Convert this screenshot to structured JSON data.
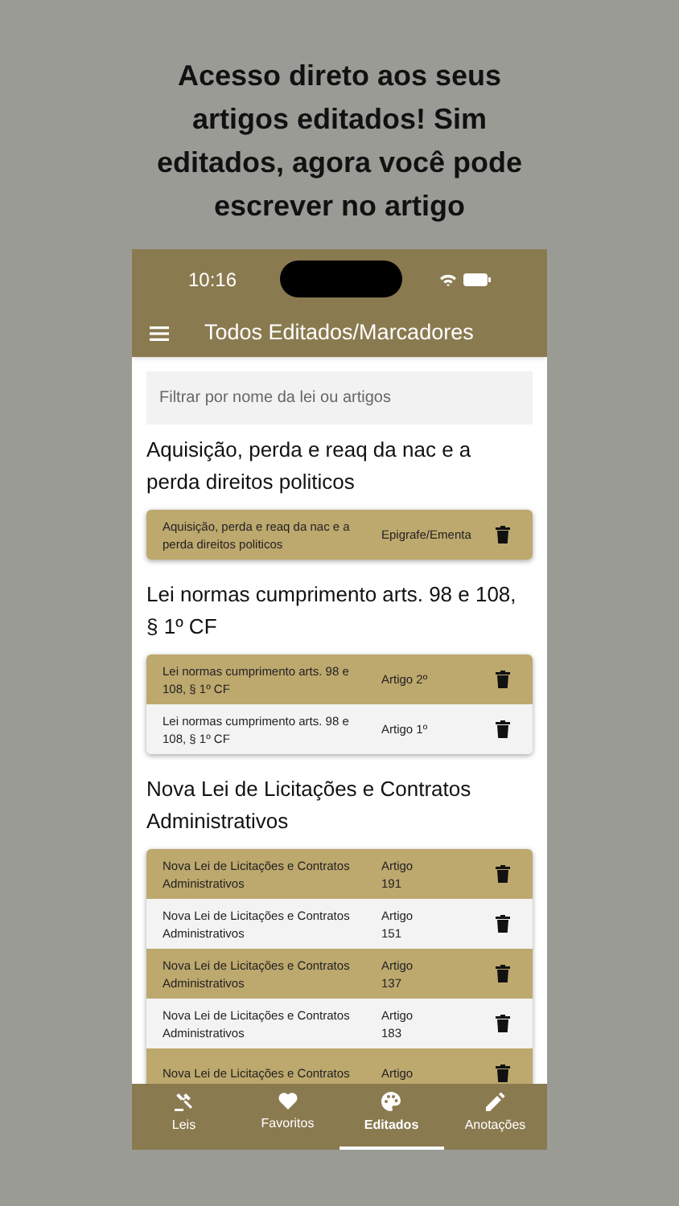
{
  "headline": "Acesso direto aos seus artigos editados! Sim editados, agora você pode escrever no artigo",
  "status_bar": {
    "time": "10:16"
  },
  "app_bar": {
    "title": "Todos Editados/Marcadores"
  },
  "search": {
    "placeholder": "Filtrar por nome da lei ou artigos"
  },
  "sections": [
    {
      "title": "Aquisição, perda e reaq da nac e a perda direitos politicos",
      "rows": [
        {
          "law": "Aquisição, perda e reaq da nac e a perda direitos politicos",
          "article": "Epigrafe/Ementa",
          "highlighted": true
        }
      ]
    },
    {
      "title": "Lei normas cumprimento arts. 98 e 108, § 1º CF",
      "rows": [
        {
          "law": "Lei normas cumprimento arts. 98 e 108, § 1º CF",
          "article": "Artigo 2º",
          "highlighted": true
        },
        {
          "law": "Lei normas cumprimento arts. 98 e 108, § 1º CF",
          "article": "Artigo 1º",
          "highlighted": false
        }
      ]
    },
    {
      "title": "Nova Lei de Licitações e Contratos Administrativos",
      "rows": [
        {
          "law": "Nova Lei de Licitações e Contratos Administrativos",
          "article": "Artigo 191",
          "highlighted": true
        },
        {
          "law": "Nova Lei de Licitações e Contratos Administrativos",
          "article": "Artigo 151",
          "highlighted": false
        },
        {
          "law": "Nova Lei de Licitações e Contratos Administrativos",
          "article": "Artigo 137",
          "highlighted": true
        },
        {
          "law": "Nova Lei de Licitações e Contratos Administrativos",
          "article": "Artigo 183",
          "highlighted": false
        },
        {
          "law": "Nova Lei de Licitações e Contratos",
          "article": "Artigo",
          "highlighted": true
        }
      ]
    }
  ],
  "tabs": [
    {
      "label": "Leis",
      "kind": "gavel",
      "selected": false
    },
    {
      "label": "Favoritos",
      "kind": "heart",
      "selected": false
    },
    {
      "label": "Editados",
      "kind": "palette",
      "selected": true
    },
    {
      "label": "Anotações",
      "kind": "pencil",
      "selected": false
    }
  ]
}
